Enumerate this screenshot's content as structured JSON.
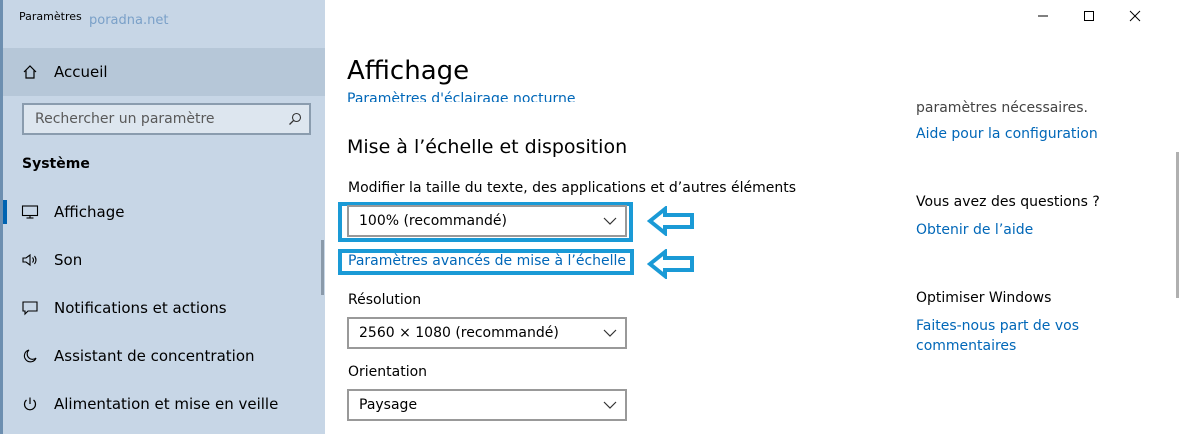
{
  "window": {
    "app_title": "Paramètres",
    "watermark": "poradna.net"
  },
  "sidebar": {
    "home_label": "Accueil",
    "search_placeholder": "Rechercher un paramètre",
    "section_title": "Système",
    "items": [
      {
        "label": "Affichage",
        "icon": "monitor-icon",
        "active": true
      },
      {
        "label": "Son",
        "icon": "speaker-icon",
        "active": false
      },
      {
        "label": "Notifications et actions",
        "icon": "message-icon",
        "active": false
      },
      {
        "label": "Assistant de concentration",
        "icon": "moon-icon",
        "active": false
      },
      {
        "label": "Alimentation et mise en veille",
        "icon": "power-icon",
        "active": false
      }
    ]
  },
  "main": {
    "title": "Affichage",
    "night_light_link": "Paramètres d'éclairage nocturne",
    "scale_section_title": "Mise à l’échelle et disposition",
    "scale_label": "Modifier la taille du texte, des applications et d’autres éléments",
    "scale_value": "100% (recommandé)",
    "advanced_scale_link": "Paramètres avancés de mise à l’échelle",
    "resolution_label": "Résolution",
    "resolution_value": "2560 × 1080 (recommandé)",
    "orientation_label": "Orientation",
    "orientation_value": "Paysage"
  },
  "aside": {
    "needed_text": "paramètres nécessaires.",
    "config_help_link": "Aide pour la configuration",
    "questions_title": "Vous avez des questions ?",
    "get_help_link": "Obtenir de l’aide",
    "improve_title": "Optimiser Windows",
    "feedback_link_line1": "Faites-nous part de vos",
    "feedback_link_line2": "commentaires"
  },
  "colors": {
    "accent": "#0067b8",
    "sidebar_bg": "#c7d6e6",
    "highlight": "#1a9ad6"
  }
}
